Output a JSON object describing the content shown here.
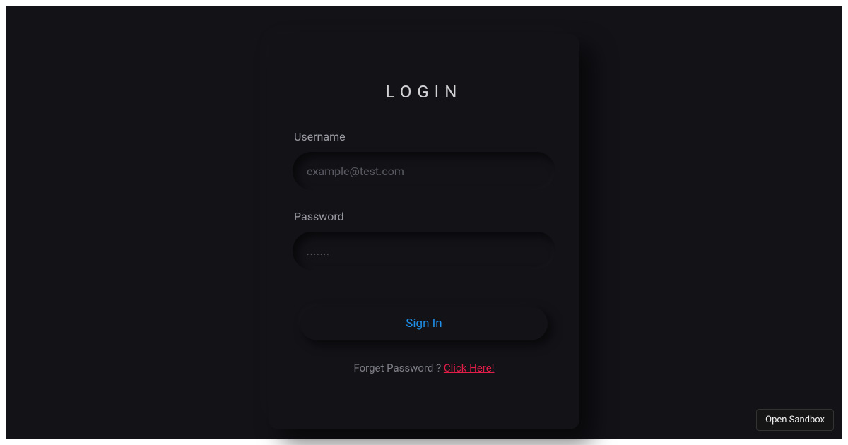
{
  "login": {
    "title": "LOGIN",
    "username_label": "Username",
    "username_placeholder": "example@test.com",
    "username_value": "",
    "password_label": "Password",
    "password_placeholder": ".......",
    "password_value": "",
    "signin_label": "Sign In",
    "forgot_text": "Forget Password ? ",
    "forgot_link": "Click Here!"
  },
  "footer": {
    "open_sandbox_label": "Open Sandbox"
  },
  "colors": {
    "background": "#121217",
    "text_muted": "#9a9ba3",
    "text_heading": "#d2d2d5",
    "accent_link": "#1f8fe8",
    "danger_link": "#e11d48"
  }
}
